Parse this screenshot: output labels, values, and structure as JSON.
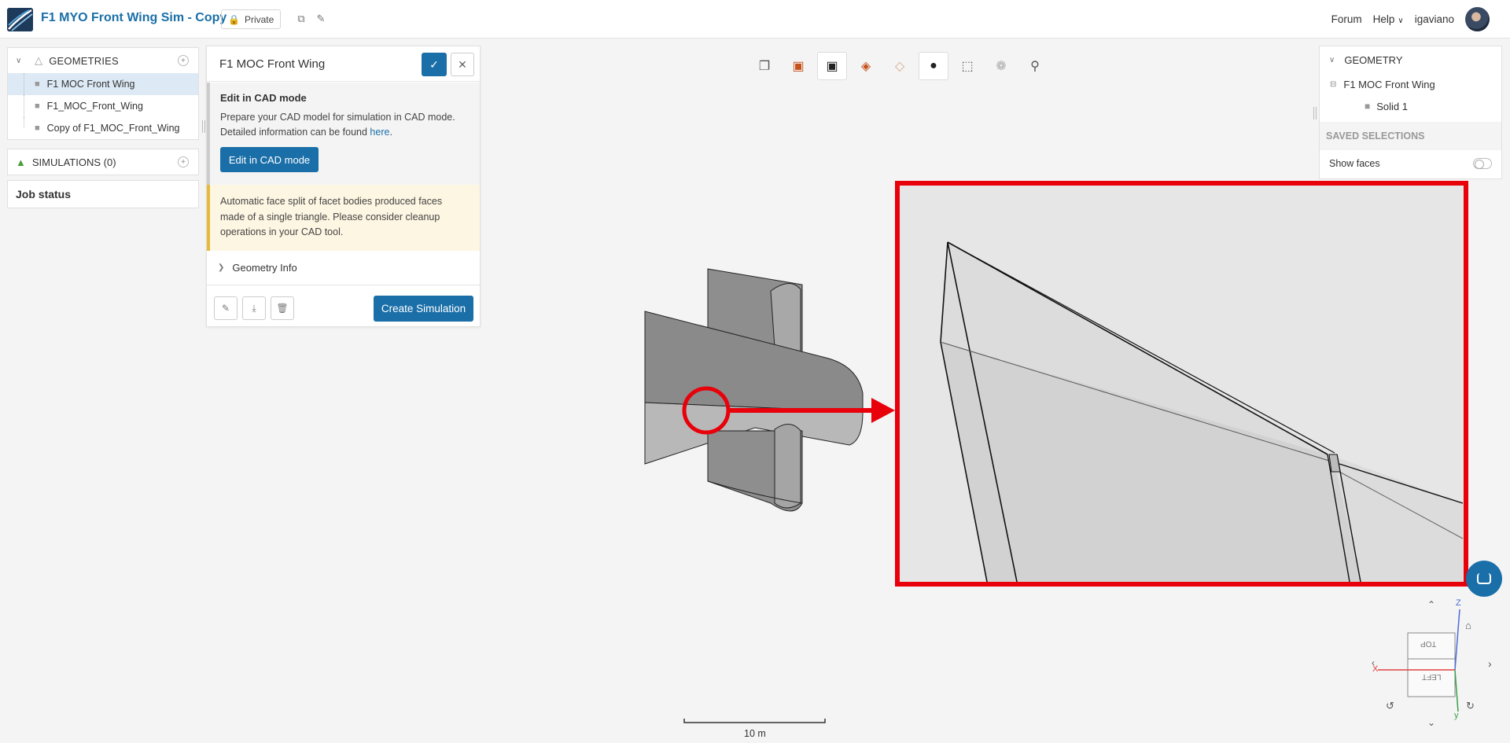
{
  "header": {
    "project_title": "F1 MYO Front Wing Sim - Copy",
    "privacy_label": "Private",
    "forum_label": "Forum",
    "help_label": "Help",
    "username": "igaviano"
  },
  "tree": {
    "geometries_label": "GEOMETRIES",
    "geometries": [
      {
        "label": "F1 MOC Front Wing",
        "selected": true
      },
      {
        "label": "F1_MOC_Front_Wing",
        "selected": false
      },
      {
        "label": "Copy of F1_MOC_Front_Wing",
        "selected": false
      }
    ],
    "simulations_label": "SIMULATIONS (0)",
    "job_status_label": "Job status"
  },
  "dialog": {
    "title": "F1 MOC Front Wing",
    "cad_title": "Edit in CAD mode",
    "cad_text": "Prepare your CAD model for simulation in CAD mode. Detailed information can be found",
    "cad_link": "here",
    "cad_button": "Edit in CAD mode",
    "warning_text": "Automatic face split of facet bodies produced faces made of a single triangle. Please consider cleanup operations in your CAD tool.",
    "geometry_info_label": "Geometry Info",
    "create_button": "Create Simulation"
  },
  "right_panel": {
    "geometry_label": "GEOMETRY",
    "model_label": "F1 MOC Front Wing",
    "solid_label": "Solid 1",
    "saved_selections_label": "SAVED SELECTIONS",
    "show_faces_label": "Show faces",
    "show_faces_on": false
  },
  "viewcube": {
    "top_label": "TOP",
    "left_label": "LEFT",
    "axis_z": "Z",
    "axis_x": "X",
    "axis_y": "y"
  },
  "scale_bar": {
    "label": "10 m"
  },
  "colors": {
    "accent": "#1a6fa8",
    "annotation_red": "#e8000a",
    "warning_bar": "#e6b93b",
    "selected_row": "#dde9f4"
  }
}
